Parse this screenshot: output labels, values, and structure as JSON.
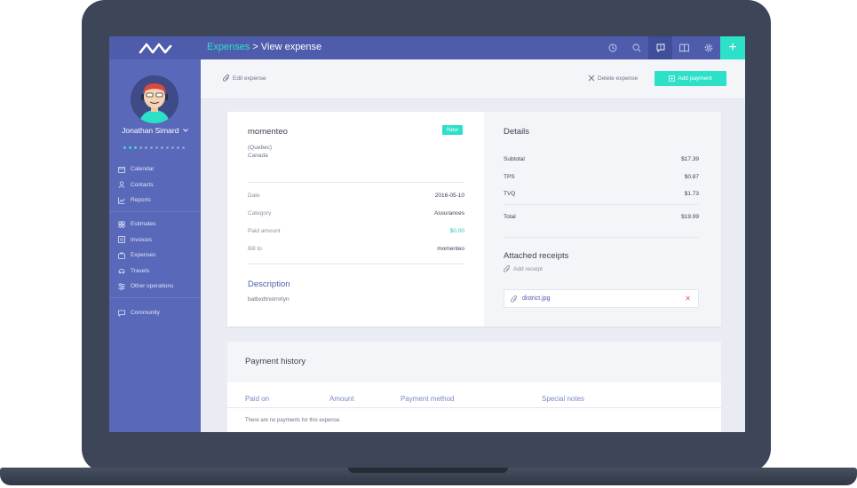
{
  "app": {
    "breadcrumb_parent": "Expenses",
    "breadcrumb_separator": ">",
    "breadcrumb_current": "View expense"
  },
  "user": {
    "name": "Jonathan Simard"
  },
  "sidebar": {
    "group1": [
      {
        "label": "Calendar",
        "icon": "calendar-icon"
      },
      {
        "label": "Contacts",
        "icon": "contacts-icon"
      },
      {
        "label": "Reports",
        "icon": "reports-icon"
      }
    ],
    "group2": [
      {
        "label": "Estimates",
        "icon": "estimates-icon"
      },
      {
        "label": "Invoices",
        "icon": "invoices-icon"
      },
      {
        "label": "Expenses",
        "icon": "expenses-icon"
      },
      {
        "label": "Travels",
        "icon": "travels-icon"
      },
      {
        "label": "Other operations",
        "icon": "other-operations-icon"
      }
    ],
    "group3": [
      {
        "label": "Community",
        "icon": "community-icon"
      }
    ]
  },
  "toolbar": {
    "edit_label": "Edit expense",
    "delete_label": "Delete expense",
    "add_payment_label": "Add payment",
    "plus": "+"
  },
  "expense": {
    "company": "momenteo",
    "status": "New",
    "address_line1": "(Quebec)",
    "address_line2": "Canada",
    "fields": [
      {
        "label": "Date",
        "value": "2016-05-10"
      },
      {
        "label": "Category",
        "value": "Assurances"
      },
      {
        "label": "Paid amount",
        "value": "$0.00"
      },
      {
        "label": "Bill to",
        "value": "momenteo"
      }
    ],
    "description_title": "Description",
    "description": "batbxdtnstrnrtyn"
  },
  "details": {
    "title": "Details",
    "rows": [
      {
        "label": "Subtotal",
        "value": "$17.39"
      },
      {
        "label": "TPS",
        "value": "$0.87"
      },
      {
        "label": "TVQ",
        "value": "$1.73"
      }
    ],
    "total_label": "Total",
    "total_value": "$19.99",
    "receipts_title": "Attached receipts",
    "add_receipt_label": "Add receipt",
    "file_name": "district.jpg",
    "remove": "✕"
  },
  "payment_history": {
    "title": "Payment history",
    "columns": [
      "Paid on",
      "Amount",
      "Payment method",
      "Special notes"
    ],
    "empty": "There are no payments for this expense."
  },
  "colors": {
    "sidebar": "#5a68b9",
    "topbar": "#4e5cab",
    "accent": "#2de0c8",
    "laptop_frame": "#3c4658"
  }
}
